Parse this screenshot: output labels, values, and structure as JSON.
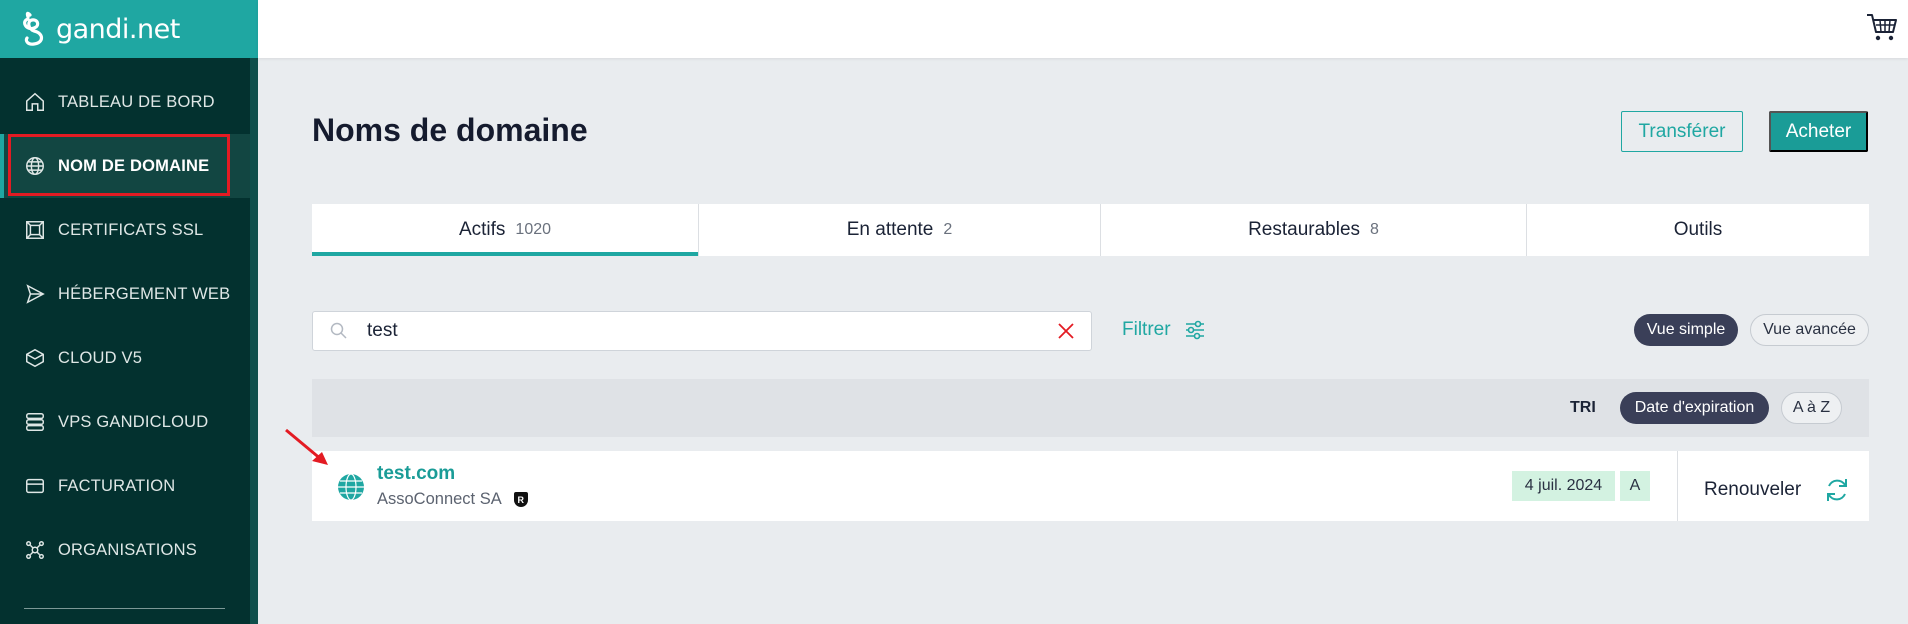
{
  "brand": {
    "name": "gandi.net",
    "accent": "#1fa7a2",
    "sidebar_bg": "#03312f"
  },
  "sidebar": {
    "items": [
      {
        "label": "TABLEAU DE BORD",
        "icon": "home-icon"
      },
      {
        "label": "NOM DE DOMAINE",
        "icon": "globe-icon",
        "active": true
      },
      {
        "label": "CERTIFICATS SSL",
        "icon": "certificate-icon"
      },
      {
        "label": "HÉBERGEMENT WEB",
        "icon": "send-icon"
      },
      {
        "label": "CLOUD V5",
        "icon": "cube-icon"
      },
      {
        "label": "VPS GANDICLOUD",
        "icon": "server-stack-icon"
      },
      {
        "label": "FACTURATION",
        "icon": "credit-card-icon"
      },
      {
        "label": "ORGANISATIONS",
        "icon": "organization-icon"
      }
    ]
  },
  "topbar": {
    "cart_icon": "cart-icon"
  },
  "main": {
    "title": "Noms de domaine",
    "transfer_label": "Transférer",
    "buy_label": "Acheter",
    "tabs": [
      {
        "label": "Actifs",
        "count": "1020",
        "active": true
      },
      {
        "label": "En attente",
        "count": "2"
      },
      {
        "label": "Restaurables",
        "count": "8"
      },
      {
        "label": "Outils",
        "count": ""
      }
    ],
    "search": {
      "value": "test",
      "placeholder": ""
    },
    "filter_label": "Filtrer",
    "view_simple": "Vue simple",
    "view_advanced": "Vue avancée",
    "sort": {
      "label": "TRI",
      "by_expiration": "Date d'expiration",
      "alpha": "A à Z"
    },
    "domains": [
      {
        "name": "test.com",
        "owner": "AssoConnect SA",
        "registry_badge": "R",
        "expiration": "4 juil. 2024",
        "status": "A",
        "renew_label": "Renouveler"
      }
    ]
  }
}
